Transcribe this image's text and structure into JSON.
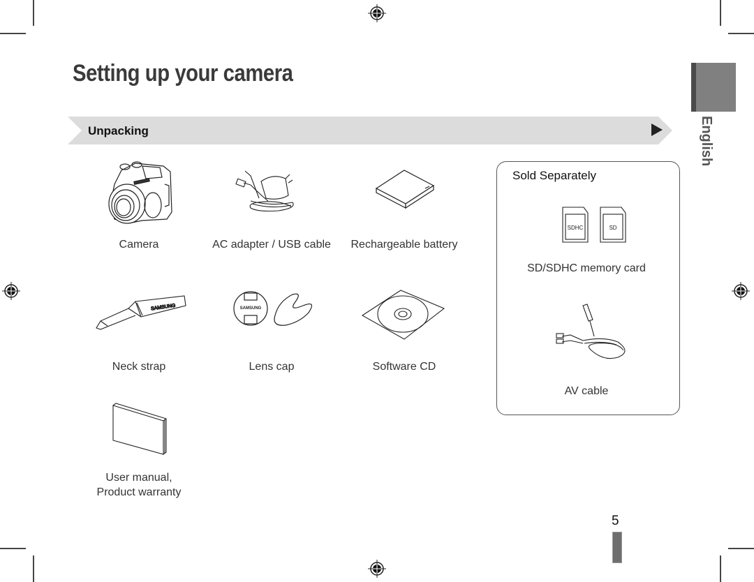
{
  "page": {
    "title": "Setting up your camera",
    "section": {
      "label": "Unpacking",
      "arrow_icon": "play-triangle-icon"
    },
    "language_tab": {
      "label": "English",
      "color": "#808080"
    },
    "included_items": [
      {
        "label": "Camera",
        "icon": "camera-icon"
      },
      {
        "label": "AC adapter / USB cable",
        "icon": "ac-adapter-icon"
      },
      {
        "label": "Rechargeable battery",
        "icon": "battery-icon"
      },
      {
        "label": "Neck strap",
        "icon": "neck-strap-icon"
      },
      {
        "label": "Lens cap",
        "icon": "lens-cap-icon"
      },
      {
        "label": "Software CD",
        "icon": "cd-icon"
      },
      {
        "label_line1": "User manual,",
        "label_line2": "Product warranty",
        "icon": "manual-icon"
      }
    ],
    "sold_separately": {
      "title": "Sold Separately",
      "items": [
        {
          "label": "SD/SDHC memory card",
          "icon": "memory-card-icon",
          "card_labels": [
            "SDHC",
            "SD"
          ]
        },
        {
          "label": "AV cable",
          "icon": "av-cable-icon"
        }
      ]
    },
    "page_number": "5",
    "lens_cap_brand": "SAMSUNG",
    "strap_brand": "SAMSUNG"
  }
}
